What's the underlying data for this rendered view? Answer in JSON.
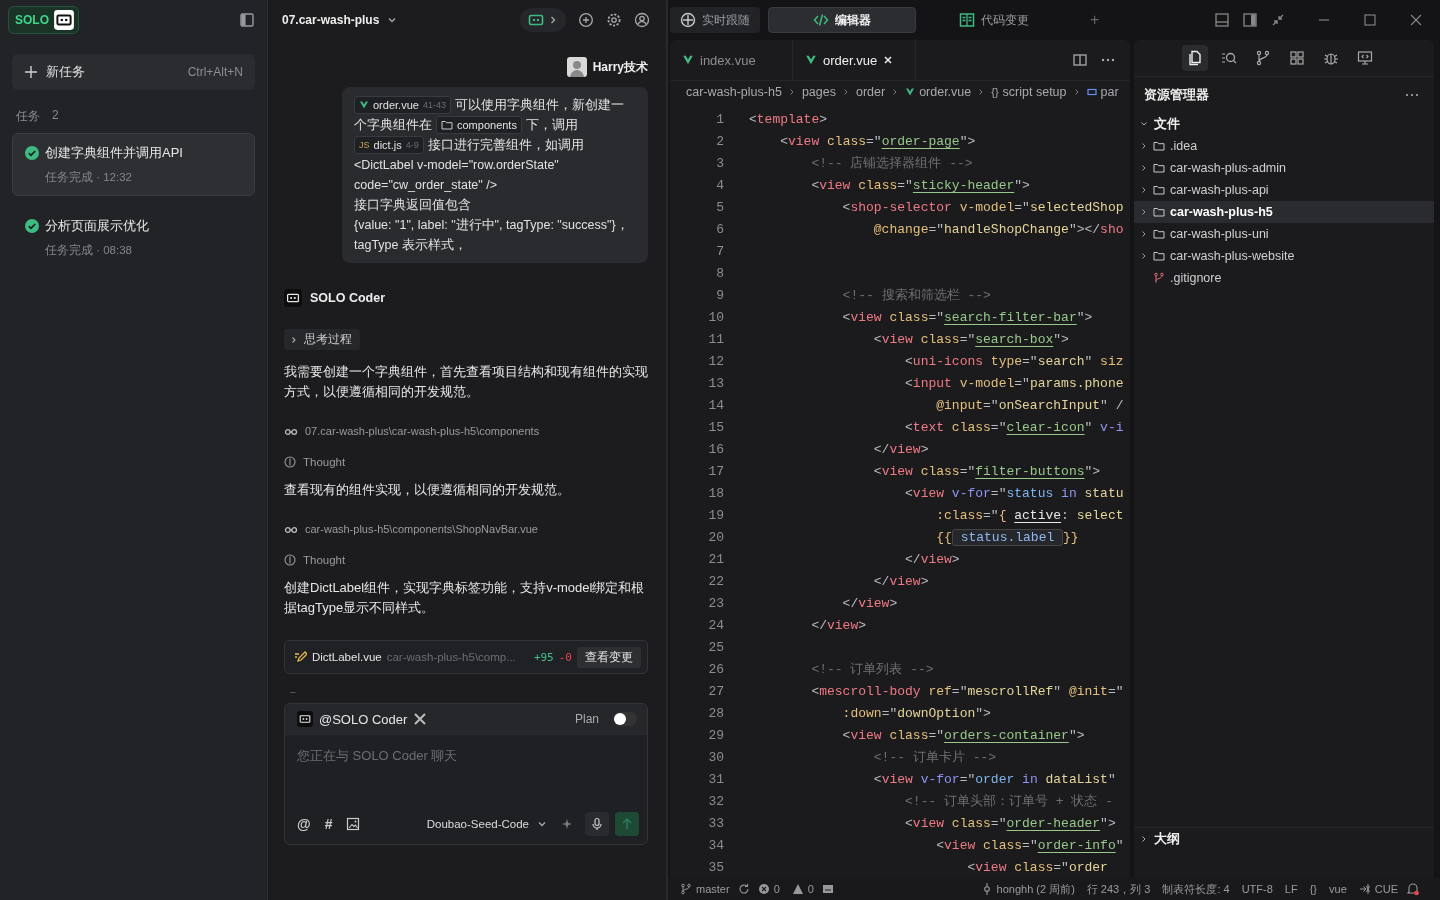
{
  "sidebar": {
    "logo": "SOLO",
    "new_task": {
      "label": "新任务",
      "shortcut": "Ctrl+Alt+N"
    },
    "tasks_heading": "任务",
    "tasks_count": "2",
    "tasks": [
      {
        "title": "创建字典组件并调用API",
        "status": "任务完成 · 12:32",
        "done": true,
        "selected": true
      },
      {
        "title": "分析页面展示优化",
        "status": "任务完成 · 08:38",
        "done": true,
        "selected": false
      }
    ]
  },
  "chat": {
    "project": "07.car-wash-plus",
    "user": "Harry技术",
    "user_message": [
      {
        "parts": [
          {
            "kind": "vue_chip",
            "label": "order.vue",
            "range": "41-43"
          },
          {
            "kind": "text",
            "text": "可以使用字典组件，新创建一"
          }
        ]
      },
      {
        "parts": [
          {
            "kind": "text",
            "text": "个字典组件在"
          },
          {
            "kind": "folder_chip",
            "label": "components"
          },
          {
            "kind": "text",
            "text": "下，调用"
          }
        ]
      },
      {
        "parts": [
          {
            "kind": "js_chip",
            "badge": "JS",
            "label": "dict.js",
            "range": "4-9"
          },
          {
            "kind": "text",
            "text": "接口进行完善组件，如调用"
          }
        ]
      },
      {
        "parts": [
          {
            "kind": "text",
            "text": "<DictLabel v-model=\"row.orderState\""
          }
        ]
      },
      {
        "parts": [
          {
            "kind": "text",
            "text": "code=\"cw_order_state\" />"
          }
        ]
      },
      {
        "parts": [
          {
            "kind": "text",
            "text": "接口字典返回值包含"
          }
        ]
      },
      {
        "parts": [
          {
            "kind": "text",
            "text": "{value: \"1\", label: \"进行中\", tagType: \"success\"}，"
          }
        ]
      },
      {
        "parts": [
          {
            "kind": "text",
            "text": "tagType 表示样式，"
          }
        ]
      }
    ],
    "agent": "SOLO Coder",
    "steps": [
      {
        "kind": "thinking",
        "label": "思考过程"
      },
      {
        "kind": "paragraph",
        "text": "我需要创建一个字典组件，首先查看项目结构和现有组件的实现方式，以便遵循相同的开发规范。"
      },
      {
        "kind": "read",
        "path": "07.car-wash-plus\\car-wash-plus-h5\\components"
      },
      {
        "kind": "thought",
        "label": "Thought"
      },
      {
        "kind": "paragraph",
        "text": "查看现有的组件实现，以便遵循相同的开发规范。"
      },
      {
        "kind": "read",
        "path": "car-wash-plus-h5\\components\\ShopNavBar.vue"
      },
      {
        "kind": "thought",
        "label": "Thought"
      },
      {
        "kind": "paragraph",
        "text": "创建DictLabel组件，实现字典标签功能，支持v-model绑定和根据tagType显示不同样式。"
      },
      {
        "kind": "change",
        "file": "DictLabel.vue",
        "path": "car-wash-plus-h5\\comp...",
        "added": "+95",
        "removed": "-0",
        "action": "查看变更"
      },
      {
        "kind": "dash",
        "text": "–"
      }
    ],
    "composer": {
      "mention": "@SOLO Coder",
      "plan_label": "Plan",
      "plan_on": false,
      "placeholder": "您正在与 SOLO Coder 聊天",
      "tools": [
        "@",
        "#"
      ],
      "model": "Doubao-Seed-Code"
    }
  },
  "editor": {
    "view_tabs": [
      {
        "label": "实时跟随",
        "selected": false
      },
      {
        "label": "编辑器",
        "selected": true
      },
      {
        "label": "代码变更",
        "selected": false
      }
    ],
    "add": "+",
    "file_tabs": [
      {
        "name": "index.vue",
        "selected": false
      },
      {
        "name": "order.vue",
        "selected": true
      }
    ],
    "breadcrumb": [
      {
        "kind": "folder",
        "label": "car-wash-plus-h5"
      },
      {
        "kind": "folder",
        "label": "pages"
      },
      {
        "kind": "folder",
        "label": "order"
      },
      {
        "kind": "file",
        "label": "order.vue"
      },
      {
        "kind": "scope",
        "glyph": "{}",
        "label": "script setup"
      },
      {
        "kind": "symbol",
        "label": "par"
      }
    ],
    "lines": [
      {
        "n": "1",
        "tokens": [
          {
            "kind": "punct",
            "text": "<"
          },
          {
            "kind": "tag",
            "text": "template"
          },
          {
            "kind": "punct",
            "text": ">"
          }
        ]
      },
      {
        "n": "2",
        "tokens": [
          {
            "kind": "punct",
            "text": "    <"
          },
          {
            "kind": "tag",
            "text": "view"
          },
          {
            "kind": "attr",
            "text": " class"
          },
          {
            "kind": "punct",
            "text": "=\""
          },
          {
            "kind": "cls",
            "text": "order-page"
          },
          {
            "kind": "punct",
            "text": "\">"
          }
        ]
      },
      {
        "n": "3",
        "tokens": [
          {
            "kind": "comment",
            "text": "        <!-- 店铺选择器组件 -->"
          }
        ]
      },
      {
        "n": "4",
        "tokens": [
          {
            "kind": "punct",
            "text": "        <"
          },
          {
            "kind": "tag",
            "text": "view"
          },
          {
            "kind": "attr",
            "text": " class"
          },
          {
            "kind": "punct",
            "text": "=\""
          },
          {
            "kind": "cls",
            "text": "sticky-header"
          },
          {
            "kind": "punct",
            "text": "\">"
          }
        ]
      },
      {
        "n": "5",
        "tokens": [
          {
            "kind": "punct",
            "text": "            <"
          },
          {
            "kind": "tag",
            "text": "shop-selector"
          },
          {
            "kind": "attr",
            "text": " v-model"
          },
          {
            "kind": "punct",
            "text": "=\""
          },
          {
            "kind": "str",
            "text": "selectedShop"
          }
        ]
      },
      {
        "n": "6",
        "tokens": [
          {
            "kind": "attr",
            "text": "                @change"
          },
          {
            "kind": "punct",
            "text": "=\""
          },
          {
            "kind": "str",
            "text": "handleShopChange"
          },
          {
            "kind": "punct",
            "text": "\"></"
          },
          {
            "kind": "tag",
            "text": "sho"
          }
        ]
      },
      {
        "n": "7"
      },
      {
        "n": "8"
      },
      {
        "n": "9",
        "tokens": [
          {
            "kind": "comment",
            "text": "            <!-- 搜索和筛选栏 -->"
          }
        ]
      },
      {
        "n": "10",
        "tokens": [
          {
            "kind": "punct",
            "text": "            <"
          },
          {
            "kind": "tag",
            "text": "view"
          },
          {
            "kind": "attr",
            "text": " class"
          },
          {
            "kind": "punct",
            "text": "=\""
          },
          {
            "kind": "cls",
            "text": "search-filter-bar"
          },
          {
            "kind": "punct",
            "text": "\">"
          }
        ]
      },
      {
        "n": "11",
        "tokens": [
          {
            "kind": "punct",
            "text": "                <"
          },
          {
            "kind": "tag",
            "text": "view"
          },
          {
            "kind": "attr",
            "text": " class"
          },
          {
            "kind": "punct",
            "text": "=\""
          },
          {
            "kind": "cls",
            "text": "search-box"
          },
          {
            "kind": "punct",
            "text": "\">"
          }
        ]
      },
      {
        "n": "12",
        "tokens": [
          {
            "kind": "punct",
            "text": "                    <"
          },
          {
            "kind": "tag",
            "text": "uni-icons"
          },
          {
            "kind": "attr",
            "text": " type"
          },
          {
            "kind": "punct",
            "text": "=\""
          },
          {
            "kind": "str",
            "text": "search"
          },
          {
            "kind": "punct",
            "text": "\""
          },
          {
            "kind": "attr",
            "text": " siz"
          }
        ]
      },
      {
        "n": "13",
        "tokens": [
          {
            "kind": "punct",
            "text": "                    <"
          },
          {
            "kind": "tag",
            "text": "input"
          },
          {
            "kind": "attr",
            "text": " v-model"
          },
          {
            "kind": "punct",
            "text": "=\""
          },
          {
            "kind": "str",
            "text": "params.phone"
          }
        ]
      },
      {
        "n": "14",
        "tokens": [
          {
            "kind": "attr",
            "text": "                        @input"
          },
          {
            "kind": "punct",
            "text": "=\""
          },
          {
            "kind": "str",
            "text": "onSearchInput"
          },
          {
            "kind": "punct",
            "text": "\" /"
          }
        ]
      },
      {
        "n": "15",
        "tokens": [
          {
            "kind": "punct",
            "text": "                    <"
          },
          {
            "kind": "tag",
            "text": "text"
          },
          {
            "kind": "attr",
            "text": " class"
          },
          {
            "kind": "punct",
            "text": "=\""
          },
          {
            "kind": "cls",
            "text": "clear-icon"
          },
          {
            "kind": "punct",
            "text": "\""
          },
          {
            "kind": "dir",
            "text": " v-i"
          }
        ]
      },
      {
        "n": "16",
        "tokens": [
          {
            "kind": "punct",
            "text": "                </"
          },
          {
            "kind": "tag",
            "text": "view"
          },
          {
            "kind": "punct",
            "text": ">"
          }
        ]
      },
      {
        "n": "17",
        "tokens": [
          {
            "kind": "punct",
            "text": "                <"
          },
          {
            "kind": "tag",
            "text": "view"
          },
          {
            "kind": "attr",
            "text": " class"
          },
          {
            "kind": "punct",
            "text": "=\""
          },
          {
            "kind": "cls",
            "text": "filter-buttons"
          },
          {
            "kind": "punct",
            "text": "\">"
          }
        ]
      },
      {
        "n": "18",
        "tokens": [
          {
            "kind": "punct",
            "text": "                    <"
          },
          {
            "kind": "tag",
            "text": "view"
          },
          {
            "kind": "dir",
            "text": " v-for"
          },
          {
            "kind": "punct",
            "text": "=\""
          },
          {
            "kind": "expr",
            "text": "status"
          },
          {
            "kind": "dir",
            "text": " in"
          },
          {
            "kind": "str",
            "text": " statu"
          }
        ]
      },
      {
        "n": "19",
        "tokens": [
          {
            "kind": "attr",
            "text": "                        :class"
          },
          {
            "kind": "punct",
            "text": "=\""
          },
          {
            "kind": "attr",
            "text": "{ "
          },
          {
            "kind": "prop",
            "text": "active"
          },
          {
            "kind": "punct",
            "text": ":"
          },
          {
            "kind": "str",
            "text": " select"
          }
        ]
      },
      {
        "n": "20",
        "tokens": [
          {
            "kind": "attr",
            "text": "                        {{"
          },
          {
            "kind": "hl",
            "text": " status.label "
          },
          {
            "kind": "attr",
            "text": "}}"
          }
        ]
      },
      {
        "n": "21",
        "tokens": [
          {
            "kind": "punct",
            "text": "                    </"
          },
          {
            "kind": "tag",
            "text": "view"
          },
          {
            "kind": "punct",
            "text": ">"
          }
        ]
      },
      {
        "n": "22",
        "tokens": [
          {
            "kind": "punct",
            "text": "                </"
          },
          {
            "kind": "tag",
            "text": "view"
          },
          {
            "kind": "punct",
            "text": ">"
          }
        ]
      },
      {
        "n": "23",
        "tokens": [
          {
            "kind": "punct",
            "text": "            </"
          },
          {
            "kind": "tag",
            "text": "view"
          },
          {
            "kind": "punct",
            "text": ">"
          }
        ]
      },
      {
        "n": "24",
        "tokens": [
          {
            "kind": "punct",
            "text": "        </"
          },
          {
            "kind": "tag",
            "text": "view"
          },
          {
            "kind": "punct",
            "text": ">"
          }
        ]
      },
      {
        "n": "25"
      },
      {
        "n": "26",
        "tokens": [
          {
            "kind": "comment",
            "text": "        <!-- 订单列表 -->"
          }
        ]
      },
      {
        "n": "27",
        "tokens": [
          {
            "kind": "punct",
            "text": "        <"
          },
          {
            "kind": "tag",
            "text": "mescroll-body"
          },
          {
            "kind": "attr",
            "text": " ref"
          },
          {
            "kind": "punct",
            "text": "=\""
          },
          {
            "kind": "str",
            "text": "mescrollRef"
          },
          {
            "kind": "punct",
            "text": "\""
          },
          {
            "kind": "attr",
            "text": " @init"
          },
          {
            "kind": "punct",
            "text": "=\""
          }
        ]
      },
      {
        "n": "28",
        "tokens": [
          {
            "kind": "attr",
            "text": "            :down"
          },
          {
            "kind": "punct",
            "text": "=\""
          },
          {
            "kind": "str",
            "text": "downOption"
          },
          {
            "kind": "punct",
            "text": "\">"
          }
        ]
      },
      {
        "n": "29",
        "tokens": [
          {
            "kind": "punct",
            "text": "            <"
          },
          {
            "kind": "tag",
            "text": "view"
          },
          {
            "kind": "attr",
            "text": " class"
          },
          {
            "kind": "punct",
            "text": "=\""
          },
          {
            "kind": "cls",
            "text": "orders-container"
          },
          {
            "kind": "punct",
            "text": "\">"
          }
        ]
      },
      {
        "n": "30",
        "tokens": [
          {
            "kind": "comment",
            "text": "                <!-- 订单卡片 -->"
          }
        ]
      },
      {
        "n": "31",
        "tokens": [
          {
            "kind": "punct",
            "text": "                <"
          },
          {
            "kind": "tag",
            "text": "view"
          },
          {
            "kind": "dir",
            "text": " v-for"
          },
          {
            "kind": "punct",
            "text": "=\""
          },
          {
            "kind": "expr",
            "text": "order"
          },
          {
            "kind": "dir",
            "text": " in"
          },
          {
            "kind": "str",
            "text": " dataList"
          },
          {
            "kind": "punct",
            "text": "\""
          }
        ]
      },
      {
        "n": "32",
        "tokens": [
          {
            "kind": "comment",
            "text": "                    <!-- 订单头部：订单号 + 状态 -"
          }
        ]
      },
      {
        "n": "33",
        "tokens": [
          {
            "kind": "punct",
            "text": "                    <"
          },
          {
            "kind": "tag",
            "text": "view"
          },
          {
            "kind": "attr",
            "text": " class"
          },
          {
            "kind": "punct",
            "text": "=\""
          },
          {
            "kind": "cls",
            "text": "order-header"
          },
          {
            "kind": "punct",
            "text": "\">"
          }
        ]
      },
      {
        "n": "34",
        "tokens": [
          {
            "kind": "punct",
            "text": "                        <"
          },
          {
            "kind": "tag",
            "text": "view"
          },
          {
            "kind": "attr",
            "text": " class"
          },
          {
            "kind": "punct",
            "text": "=\""
          },
          {
            "kind": "cls",
            "text": "order-info"
          },
          {
            "kind": "punct",
            "text": "\""
          }
        ]
      },
      {
        "n": "35",
        "tokens": [
          {
            "kind": "punct",
            "text": "                            <"
          },
          {
            "kind": "tag",
            "text": "view"
          },
          {
            "kind": "attr",
            "text": " class"
          },
          {
            "kind": "punct",
            "text": "=\""
          },
          {
            "kind": "str",
            "text": "order"
          }
        ]
      }
    ]
  },
  "explorer": {
    "title": "资源管理器",
    "section": {
      "label": "文件",
      "expanded": true
    },
    "items": [
      {
        "name": ".idea",
        "kind": "folder",
        "selected": false
      },
      {
        "name": "car-wash-plus-admin",
        "kind": "folder",
        "selected": false
      },
      {
        "name": "car-wash-plus-api",
        "kind": "folder",
        "selected": false
      },
      {
        "name": "car-wash-plus-h5",
        "kind": "folder",
        "selected": true
      },
      {
        "name": "car-wash-plus-uni",
        "kind": "folder",
        "selected": false
      },
      {
        "name": "car-wash-plus-website",
        "kind": "folder",
        "selected": false
      },
      {
        "name": ".gitignore",
        "kind": "git",
        "selected": false
      }
    ],
    "outline": {
      "label": "大纲",
      "expanded": false
    }
  },
  "status_bar": {
    "branch": "master",
    "errors": "0",
    "warnings": "0",
    "right": [
      {
        "kind": "blame",
        "text": "honghh (2 周前)"
      },
      {
        "kind": "text",
        "text": "行 243，列 3"
      },
      {
        "kind": "text",
        "text": "制表符长度: 4"
      },
      {
        "kind": "text",
        "text": "UTF-8"
      },
      {
        "kind": "text",
        "text": "LF"
      },
      {
        "kind": "text",
        "text": "{}"
      },
      {
        "kind": "text",
        "text": "vue"
      },
      {
        "kind": "cue",
        "text": "CUE"
      }
    ]
  }
}
